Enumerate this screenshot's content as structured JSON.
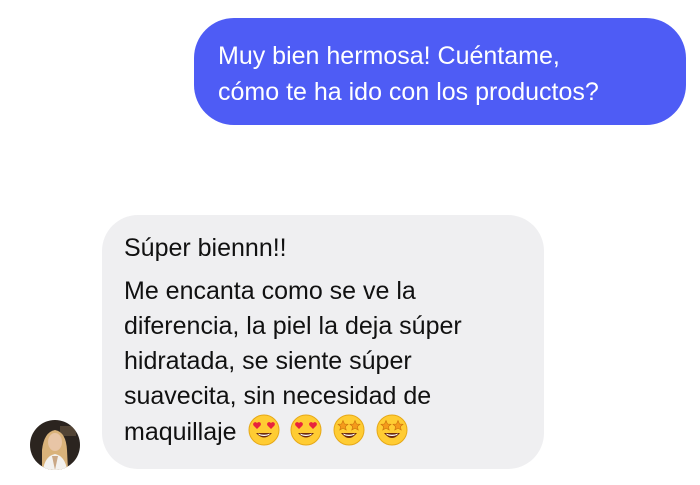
{
  "outgoing_message": {
    "lines": [
      "Muy bien hermosa! Cuéntame,",
      "cómo te ha ido con los productos?"
    ]
  },
  "incoming_message": {
    "greeting": "Súper biennn!!",
    "lines": [
      "Me encanta como se ve la",
      "diferencia, la piel la deja súper",
      "hidratada, se siente súper",
      "suavecita, sin necesidad de",
      "maquillaje"
    ],
    "emojis": [
      "smiling-face-with-heart-eyes",
      "smiling-face-with-heart-eyes",
      "star-struck",
      "star-struck"
    ]
  },
  "colors": {
    "outgoing_bubble": "#4e5cf5",
    "incoming_bubble": "#efeff1"
  }
}
